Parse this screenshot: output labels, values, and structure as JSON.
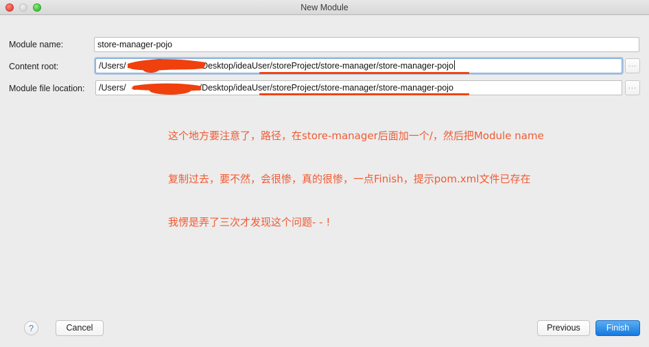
{
  "window": {
    "title": "New Module",
    "traffic_lights": [
      "close-button",
      "minimize-button",
      "zoom-button"
    ]
  },
  "form": {
    "module_name": {
      "label": "Module name:",
      "value": "store-manager-pojo",
      "placeholder": ""
    },
    "content_root": {
      "label": "Content root:",
      "value_prefix": "/Users/",
      "value_suffix": "/Desktop/ideaUser/storeProject/store-manager/store-manager-pojo",
      "placeholder": "",
      "browse_label": "...",
      "redacted": true,
      "focused": true
    },
    "module_file_location": {
      "label": "Module file location:",
      "value_prefix": "/Users/",
      "value_suffix": "/Desktop/ideaUser/storeProject/store-manager/store-manager-pojo",
      "placeholder": "",
      "browse_label": "...",
      "redacted": true,
      "focused": false
    }
  },
  "annotation": {
    "color": "#f15a33",
    "lines": [
      "这个地方要注意了，路径，在store-manager后面加一个/，然后把Module name",
      "复制过去，要不然，会很惨，真的很惨，一点Finish，提示pom.xml文件已存在",
      "我愣是弄了三次才发现这个问题- - !"
    ]
  },
  "footer": {
    "help_label": "?",
    "cancel_label": "Cancel",
    "previous_label": "Previous",
    "finish_label": "Finish",
    "finish_accent": "#1479e0"
  }
}
